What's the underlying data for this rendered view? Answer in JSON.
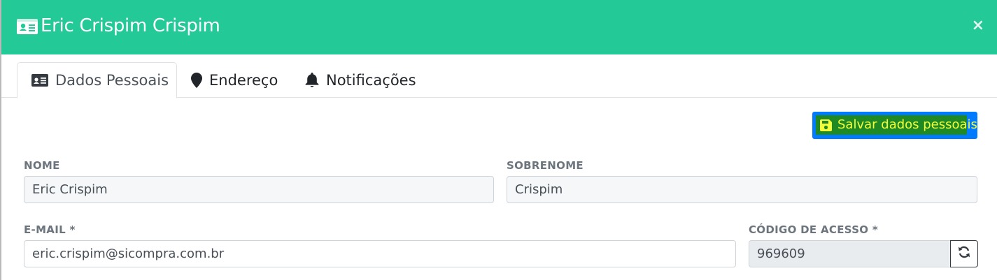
{
  "header": {
    "title": "Eric Crispim Crispim",
    "icon": "id-card-icon",
    "close_symbol": "×",
    "background": "#23c997"
  },
  "tabs": [
    {
      "label": "Dados Pessoais",
      "icon": "id-card-icon",
      "active": true
    },
    {
      "label": "Endereço",
      "icon": "map-marker-icon",
      "active": false
    },
    {
      "label": "Notificações",
      "icon": "bell-icon",
      "active": false
    }
  ],
  "toolbar": {
    "save_label": "Salvar dados pessoais",
    "save_icon": "floppy-disk-icon",
    "save_color": "#007bff"
  },
  "form": {
    "nome": {
      "label": "NOME",
      "value": "Eric Crispim"
    },
    "sobrenome": {
      "label": "SOBRENOME",
      "value": "Crispim"
    },
    "email": {
      "label": "E-MAIL *",
      "value": "eric.crispim@sicompra.com.br"
    },
    "codigo": {
      "label": "CÓDIGO DE ACESSO *",
      "value": "969609",
      "refresh_icon": "refresh-icon"
    }
  }
}
